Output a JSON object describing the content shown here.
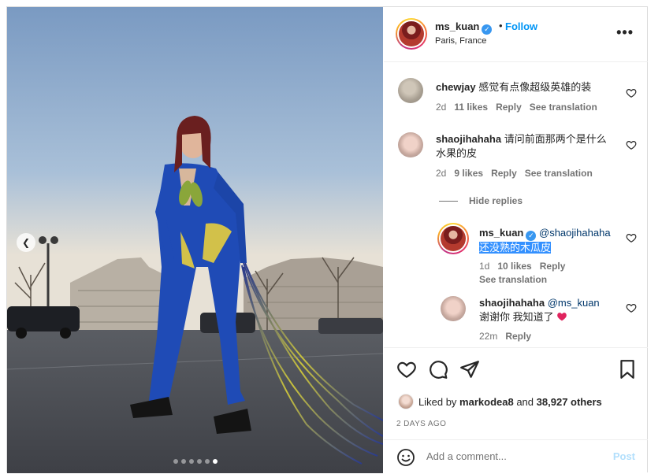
{
  "post": {
    "username": "ms_kuan",
    "follow_label": "Follow",
    "separator": "•",
    "location": "Paris, France",
    "more_icon": "more-horizontal-icon",
    "carousel_dots": 6,
    "carousel_active_index": 5
  },
  "comments": [
    {
      "username": "chewjay",
      "text": "感觉有点像超级英雄的装",
      "time": "2d",
      "likes": "11 likes",
      "reply_label": "Reply",
      "translate_label": "See translation"
    },
    {
      "username": "shaojihahaha",
      "text": "请问前面那两个是什么水果的皮",
      "time": "2d",
      "likes": "9 likes",
      "reply_label": "Reply",
      "translate_label": "See translation"
    }
  ],
  "hide_replies_label": "Hide replies",
  "replies": [
    {
      "username": "ms_kuan",
      "mention": "@shaojihahaha",
      "text": "还没熟的木瓜皮",
      "time": "1d",
      "likes": "10 likes",
      "reply_label": "Reply",
      "translate_label": "See translation"
    },
    {
      "username": "shaojihahaha",
      "mention": "@ms_kuan",
      "text": "谢谢你 我知道了",
      "time": "22m",
      "reply_label": "Reply"
    }
  ],
  "likes_line": {
    "prefix": "Liked by",
    "user": "markodea8",
    "middle": "and",
    "count": "38,927 others"
  },
  "posted_ago": "2 DAYS AGO",
  "add_comment": {
    "placeholder": "Add a comment...",
    "post_label": "Post"
  },
  "colors": {
    "accent_blue": "#0095f6",
    "post_disabled": "#b2dffc",
    "muted_text": "#737373",
    "heart_red": "#e0245e",
    "selection": "#3390ff"
  }
}
